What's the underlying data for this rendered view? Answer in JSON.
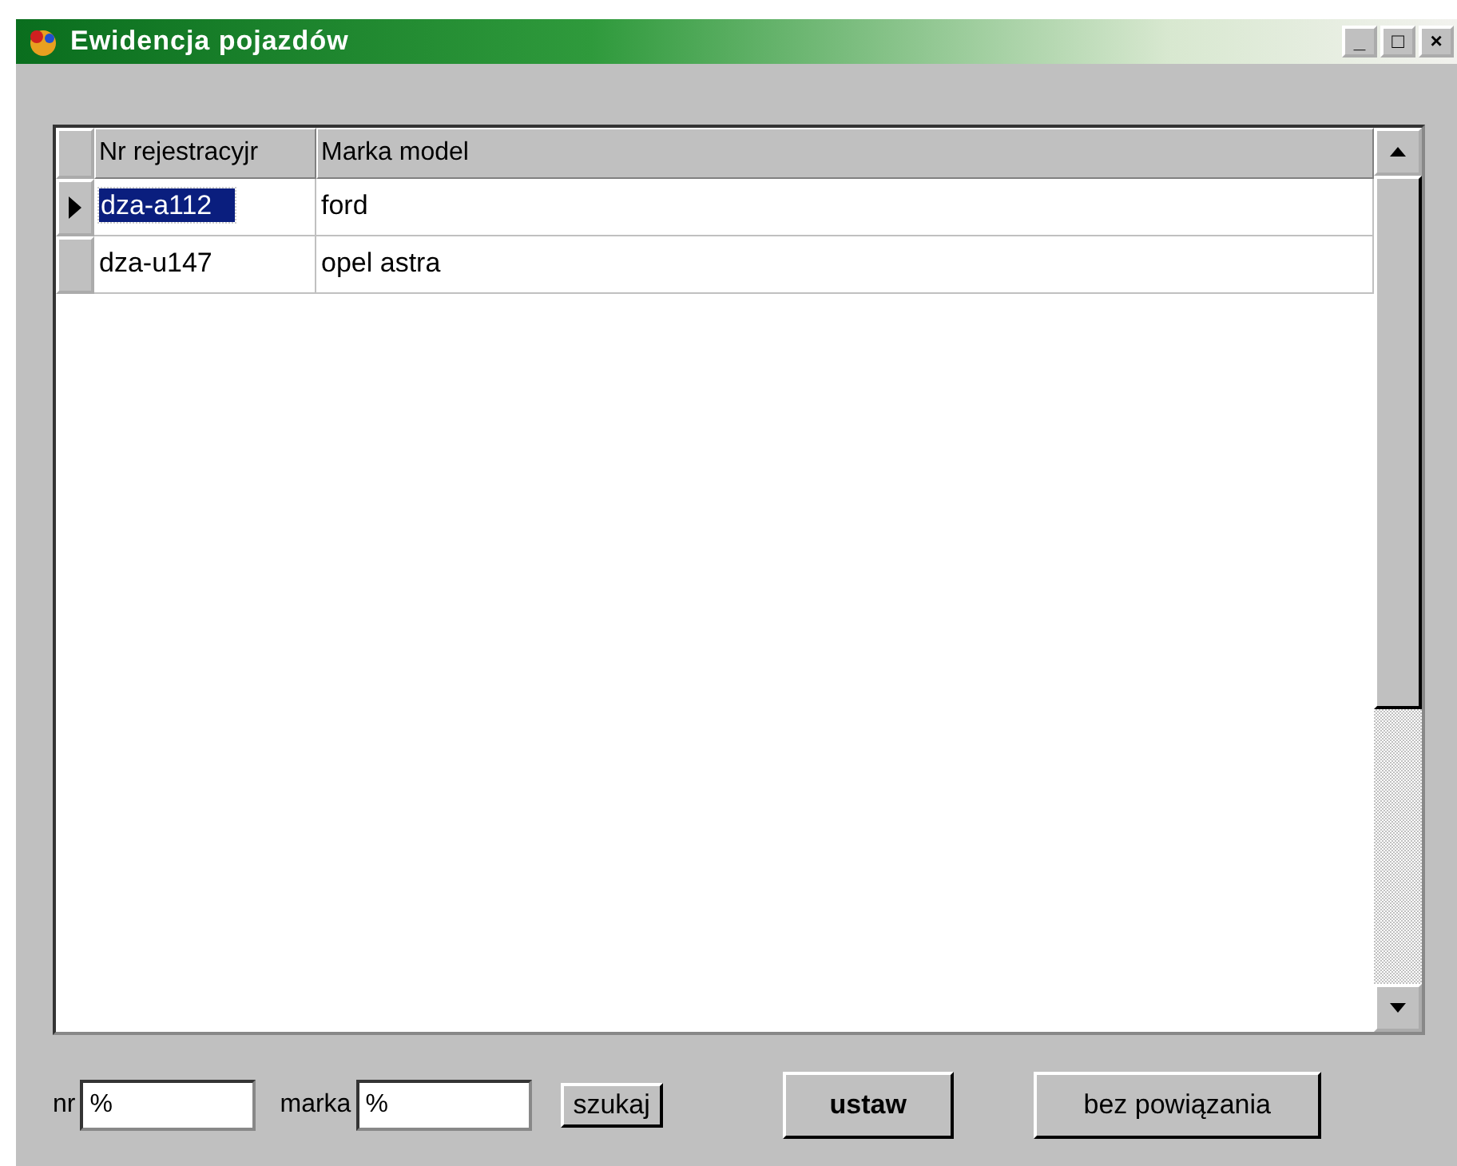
{
  "window": {
    "title": "Ewidencja pojazdów"
  },
  "title_buttons": [
    "_",
    "□",
    "×"
  ],
  "table": {
    "columns": [
      "Nr rejestracyjr",
      "Marka model"
    ],
    "rows": [
      {
        "cells": [
          "dza-a112",
          "ford"
        ],
        "selected": true
      },
      {
        "cells": [
          "dza-u147",
          "opel astra"
        ],
        "selected": false
      }
    ]
  },
  "filters": [
    {
      "label": "nr",
      "value": "%"
    },
    {
      "label": "marka",
      "value": "%"
    }
  ],
  "buttons": [
    {
      "label": "szukaj",
      "kind": "small"
    },
    {
      "label": "ustaw",
      "kind": "bold"
    },
    {
      "label": "bez powiązania",
      "kind": "normal"
    }
  ]
}
